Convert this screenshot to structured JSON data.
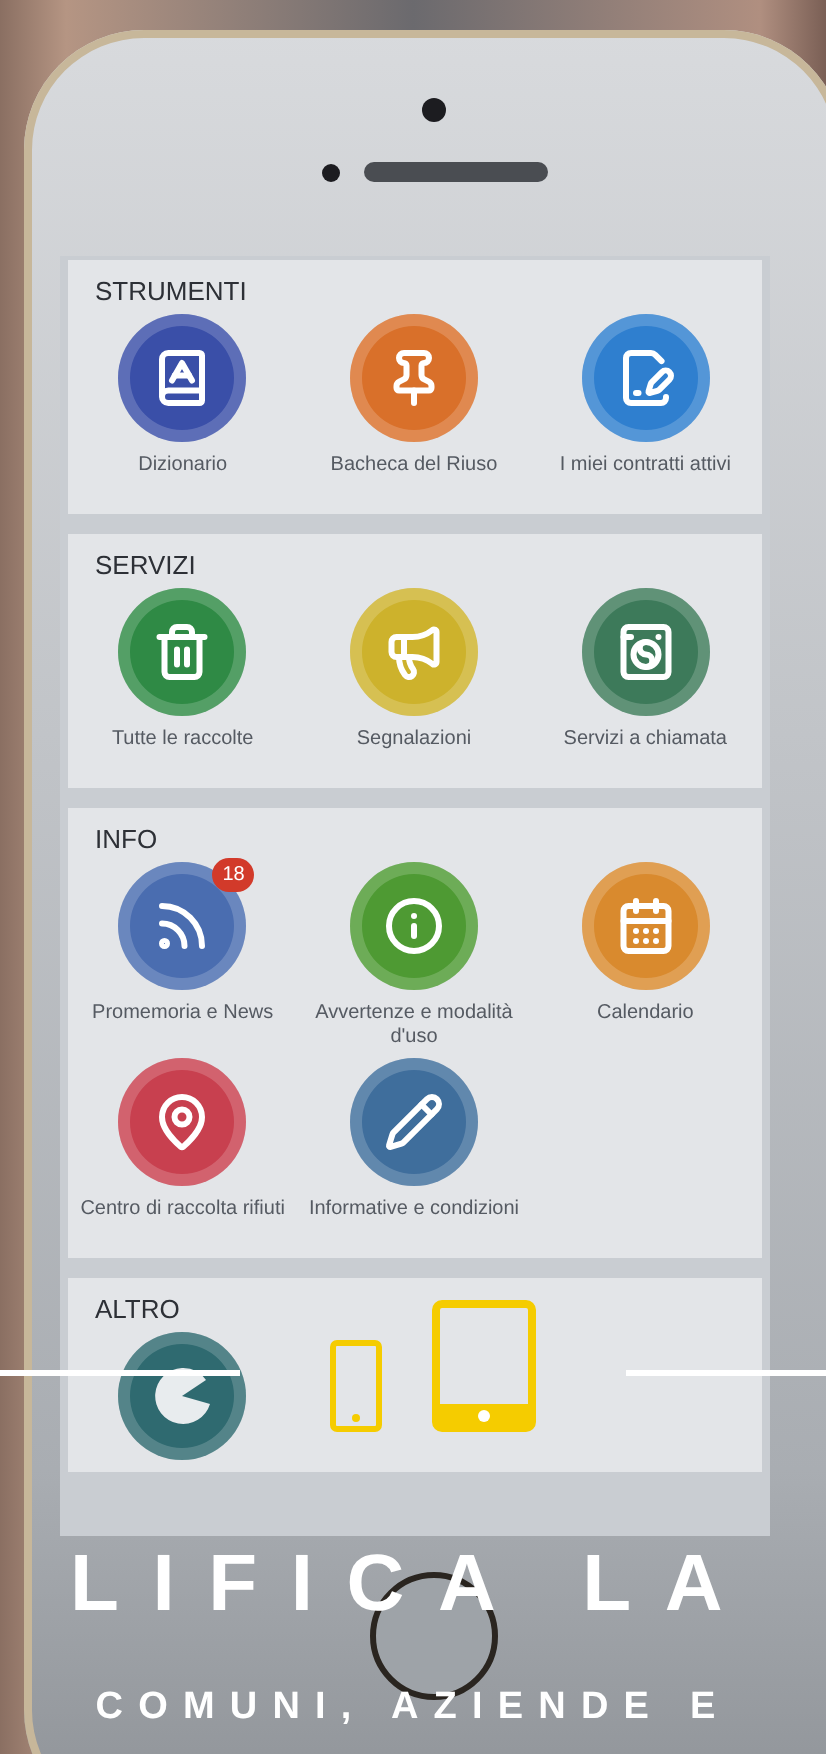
{
  "sections": [
    {
      "title": "STRUMENTI",
      "items": [
        {
          "label": "Dizionario",
          "color": "#3a4fa8"
        },
        {
          "label": "Bacheca del Riuso",
          "color": "#d9702a"
        },
        {
          "label": "I miei contratti attivi",
          "color": "#2f7fcf"
        }
      ]
    },
    {
      "title": "SERVIZI",
      "items": [
        {
          "label": "Tutte le raccolte",
          "color": "#2f8a45"
        },
        {
          "label": "Segnalazioni",
          "color": "#cdb22c"
        },
        {
          "label": "Servizi a chiamata",
          "color": "#3d7a5a"
        }
      ]
    },
    {
      "title": "INFO",
      "items": [
        {
          "label": "Promemoria e News",
          "color": "#4a6db0",
          "badge": "18"
        },
        {
          "label": "Avvertenze e modalità d'uso",
          "color": "#4e9a33"
        },
        {
          "label": "Calendario",
          "color": "#d98a2e"
        },
        {
          "label": "Centro di raccolta rifiuti",
          "color": "#c8404f"
        },
        {
          "label": "Informative e condizioni",
          "color": "#3f6e9c"
        }
      ]
    },
    {
      "title": "ALTRO",
      "items": [
        {
          "color": "#2f6a70"
        }
      ]
    }
  ],
  "hero": {
    "headline": "LIFICA LA",
    "subheadline": "COMUNI, AZIENDE E"
  }
}
